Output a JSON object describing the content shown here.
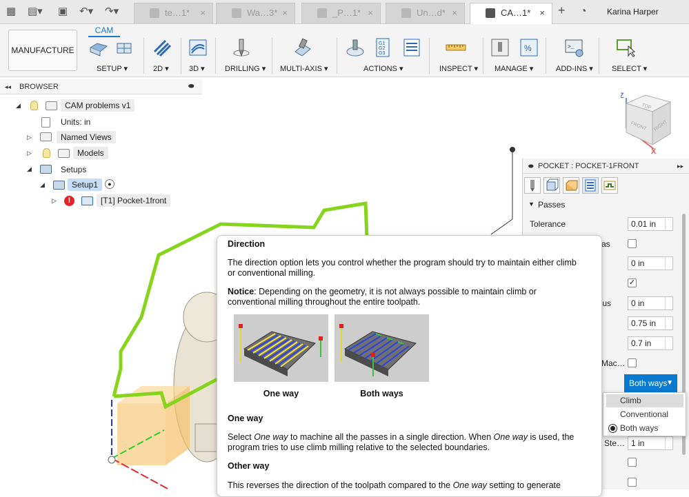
{
  "topbar": {
    "tabs": [
      {
        "label": "te…1*"
      },
      {
        "label": "Wa…3*"
      },
      {
        "label": "_P…1*"
      },
      {
        "label": "Un…d*"
      },
      {
        "label": "CA…1*"
      }
    ],
    "user": "Karina Harper",
    "icons": [
      "grid-icon",
      "file-icon",
      "save-icon",
      "undo-icon",
      "redo-icon",
      "plus-icon",
      "clock-icon"
    ]
  },
  "ribbon": {
    "workspace": "MANUFACTURE",
    "active_tab": "CAM",
    "groups": [
      "SETUP",
      "2D",
      "3D",
      "DRILLING",
      "MULTI-AXIS",
      "ACTIONS",
      "INSPECT",
      "MANAGE",
      "ADD-INS",
      "SELECT"
    ]
  },
  "browser": {
    "title": "BROWSER",
    "items": {
      "root": "CAM problems v1",
      "units": "Units: in",
      "named_views": "Named Views",
      "models": "Models",
      "setups": "Setups",
      "setup1": "Setup1",
      "operation": "[T1] Pocket-1front"
    }
  },
  "pocket_panel": {
    "title": "POCKET : POCKET-1FRONT",
    "section": "Passes",
    "tolerance_label": "Tolerance",
    "tolerance_value": "0.01 in",
    "partial_labels": [
      "as",
      "dius",
      "Mac…",
      "Ste…"
    ],
    "values": [
      "0 in",
      "0 in",
      "0.75 in",
      "0.7 in",
      "1 in"
    ],
    "direction_value": "Both ways",
    "checkbox_checked": "✓",
    "dropdown_options": [
      "Climb",
      "Conventional",
      "Both ways"
    ],
    "dropdown_selected": "Both ways"
  },
  "tooltip": {
    "title": "Direction",
    "intro": "The direction option lets you control whether the program should try to maintain either climb or conventional milling.",
    "notice_label": "Notice",
    "notice_text": ": Depending on the geometry, it is not always possible to maintain climb or conventional milling throughout the entire toolpath.",
    "fig1_caption": "One way",
    "fig2_caption": "Both ways",
    "h_one_way": "One way",
    "one_way_p1": "Select ",
    "one_way_em1": "One way",
    "one_way_p2": " to machine all the passes in a single direction. When ",
    "one_way_em2": "One way",
    "one_way_p3": " is used, the program tries to use climb milling relative to the selected boundaries.",
    "h_other_way": "Other way",
    "other_p1": "This reverses the direction of the toolpath compared to the ",
    "other_em": "One way",
    "other_p2": " setting to generate"
  },
  "viewcube": {
    "top": "TOP",
    "front": "FRONT",
    "right": "RIGHT",
    "z": "Z",
    "x": "X"
  }
}
